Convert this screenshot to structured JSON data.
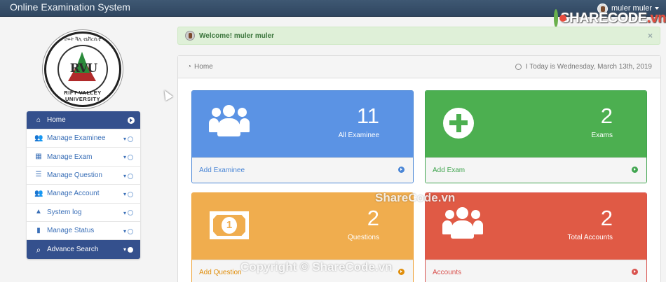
{
  "app": {
    "title": "Online Examination System"
  },
  "user": {
    "name": "muler muler"
  },
  "watermark": {
    "logo_main": "SHARECODE",
    "logo_suffix": ".vn",
    "center": "ShareCode.vn",
    "bottom": "Copyright © ShareCode.vn"
  },
  "logo": {
    "top_text": "ሪፍት ቫሊ ዩኒቨርሲቲ",
    "letters": "RVU",
    "ring_text": "RIFT VALLEY UNIVERSITY"
  },
  "sidebar": {
    "items": [
      {
        "label": "Home",
        "icon": "home-icon"
      },
      {
        "label": "Manage Examinee",
        "icon": "users-icon"
      },
      {
        "label": "Manage Exam",
        "icon": "th-icon"
      },
      {
        "label": "Manage Question",
        "icon": "list-icon"
      },
      {
        "label": "Manage Account",
        "icon": "users-icon"
      },
      {
        "label": "System log",
        "icon": "warning-icon"
      },
      {
        "label": "Manage Status",
        "icon": "book-icon"
      },
      {
        "label": "Advance Search",
        "icon": "search-icon"
      }
    ]
  },
  "alert": {
    "message": "Welcome! muler muler",
    "close": "×"
  },
  "panel": {
    "breadcrumb": "Home",
    "today": "I Today is Wednesday, March 13th, 2019"
  },
  "cards": {
    "examinee": {
      "count": "11",
      "label": "All Examinee",
      "action": "Add Examinee"
    },
    "exams": {
      "count": "2",
      "label": "Exams",
      "action": "Add Exam"
    },
    "questions": {
      "count": "2",
      "label": "Questions",
      "action": "Add Question"
    },
    "accounts": {
      "count": "2",
      "label": "Total Accounts",
      "action": "Accounts"
    }
  },
  "colors": {
    "navbar": "#34495e",
    "sidebar_active": "#34508d",
    "blue": "#5b93e4",
    "green": "#4caf50",
    "orange": "#f0ad4e",
    "red": "#e05a45"
  }
}
